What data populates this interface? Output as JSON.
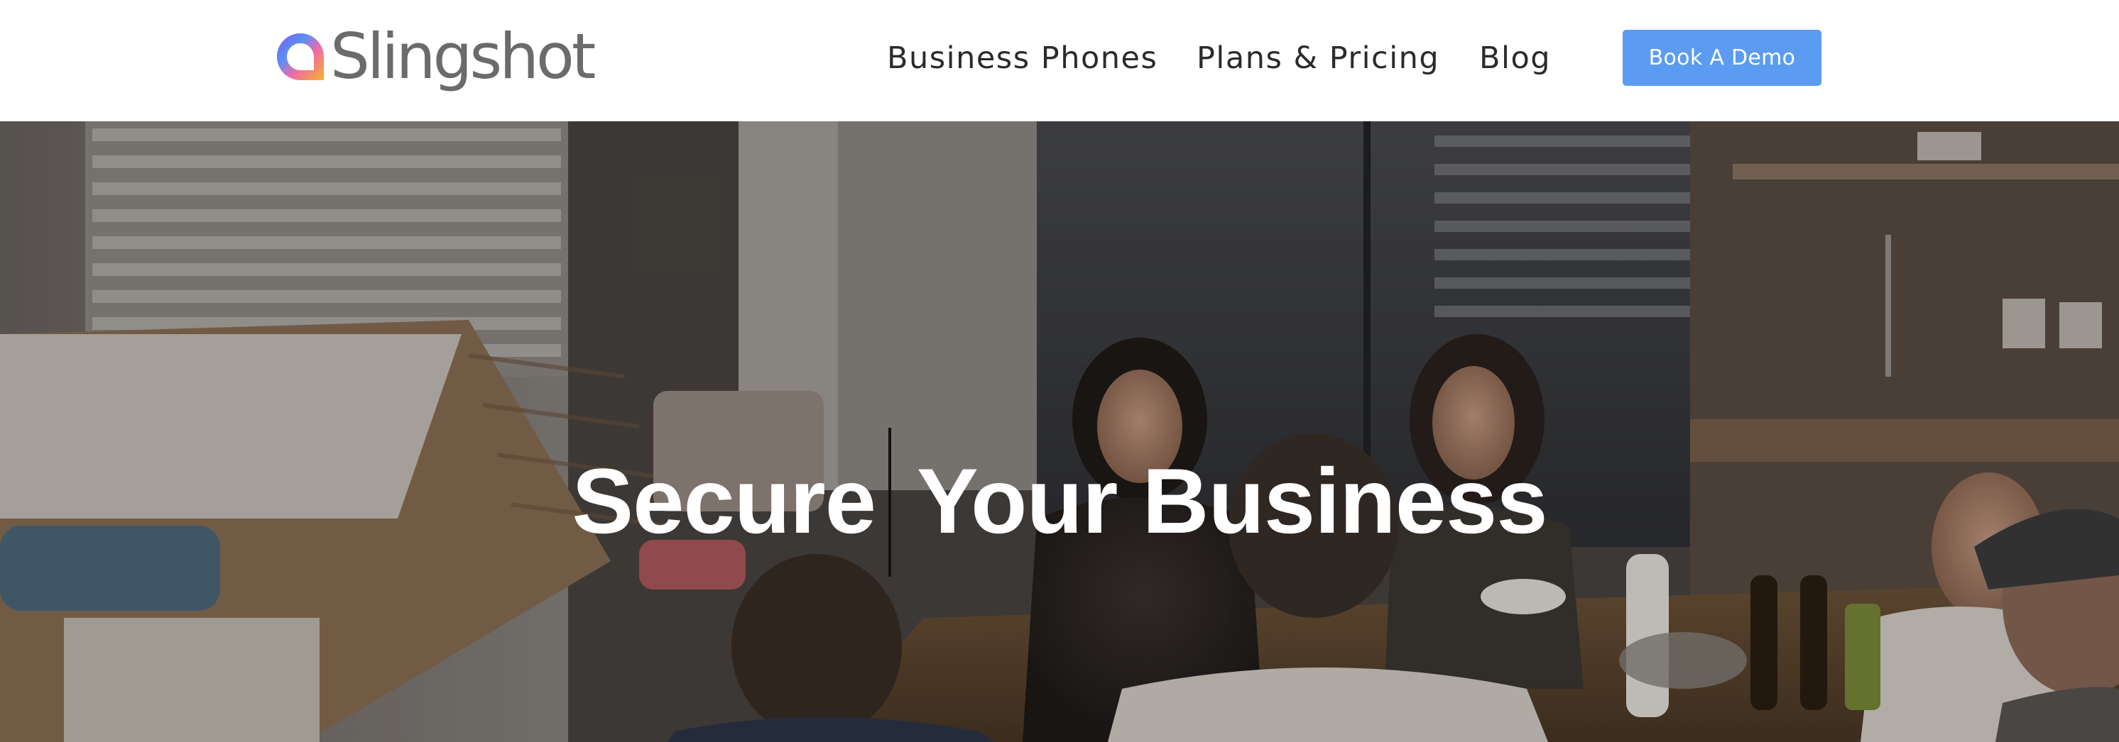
{
  "header": {
    "logo_text": "Slingshot",
    "nav": [
      {
        "label": "Business Phones"
      },
      {
        "label": "Plans & Pricing"
      },
      {
        "label": "Blog"
      }
    ],
    "cta_label": "Book A Demo",
    "cta_color": "#5b9cf2"
  },
  "hero": {
    "headline_part1": "Secure",
    "headline_part2": "Your Business",
    "headline_color": "#ffffff",
    "background_description_icon": "office-meeting-photo"
  },
  "colors": {
    "header_bg": "#ffffff",
    "nav_text": "#2b2b2b",
    "logo_text": "#6b6b6b"
  }
}
